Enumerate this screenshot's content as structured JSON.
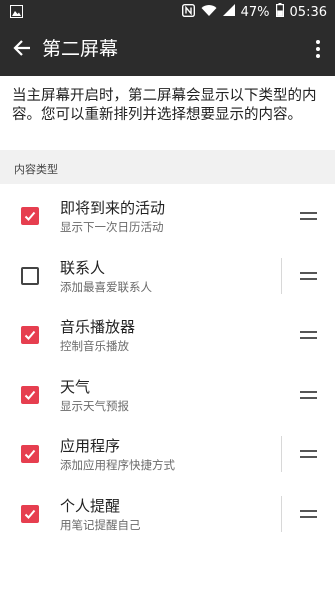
{
  "status_bar": {
    "battery": "47%",
    "time": "05:36"
  },
  "app_bar": {
    "title": "第二屏幕"
  },
  "description": "当主屏幕开启时，第二屏幕会显示以下类型的内容。您可以重新排列并选择想要显示的内容。",
  "section_header": "内容类型",
  "items": [
    {
      "title": "即将到来的活动",
      "subtitle": "显示下一次日历活动",
      "checked": true,
      "separator": false
    },
    {
      "title": "联系人",
      "subtitle": "添加最喜爱联系人",
      "checked": false,
      "separator": true
    },
    {
      "title": "音乐播放器",
      "subtitle": "控制音乐播放",
      "checked": true,
      "separator": false
    },
    {
      "title": "天气",
      "subtitle": "显示天气预报",
      "checked": true,
      "separator": false
    },
    {
      "title": "应用程序",
      "subtitle": "添加应用程序快捷方式",
      "checked": true,
      "separator": true
    },
    {
      "title": "个人提醒",
      "subtitle": "用笔记提醒自己",
      "checked": true,
      "separator": true
    }
  ],
  "colors": {
    "accent": "#e63e4f",
    "app_bar": "#2c2c2c"
  }
}
